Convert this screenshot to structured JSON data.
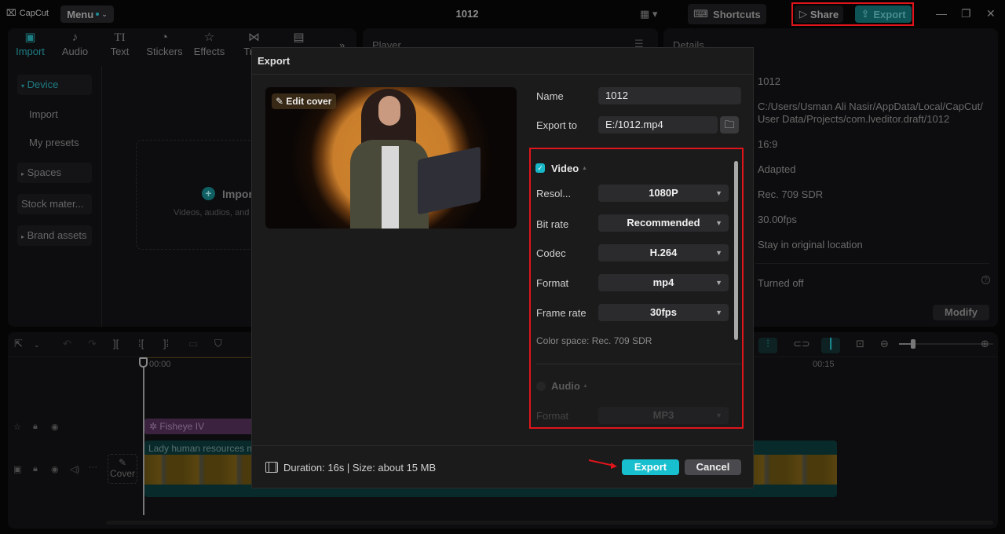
{
  "app": {
    "logo": "CapCut",
    "menu_label": "Menu",
    "project_title": "1012",
    "shortcuts_label": "Shortcuts",
    "share_label": "Share",
    "export_label": "Export",
    "accent_color": "#18bfce",
    "highlight_color": "#e0141b"
  },
  "media_tabs": [
    {
      "label": "Import",
      "icon": "import-icon",
      "active": true
    },
    {
      "label": "Audio",
      "icon": "audio-icon"
    },
    {
      "label": "Text",
      "icon": "text-icon"
    },
    {
      "label": "Stickers",
      "icon": "stickers-icon"
    },
    {
      "label": "Effects",
      "icon": "effects-icon"
    },
    {
      "label": "Tran",
      "icon": "transitions-icon"
    },
    {
      "label": "",
      "icon": "captions-icon"
    }
  ],
  "side_nav": [
    {
      "label": "Device",
      "active": true,
      "expandable": true
    },
    {
      "label": "Import"
    },
    {
      "label": "My presets"
    },
    {
      "label": "Spaces",
      "expandable": true
    },
    {
      "label": "Stock mater..."
    },
    {
      "label": "Brand assets",
      "expandable": true
    }
  ],
  "import_area": {
    "label": "Impor",
    "hint": "Videos, audios, and"
  },
  "player": {
    "label": "Player"
  },
  "details": {
    "label": "Details",
    "values": [
      "1012",
      "C:/Users/Usman Ali Nasir/AppData/Local/CapCut/",
      "User Data/Projects/com.lveditor.draft/1012",
      "16:9",
      "Adapted",
      "Rec. 709 SDR",
      "30.00fps",
      "Stay in original location",
      "Turned off"
    ],
    "modify_label": "Modify"
  },
  "timeline": {
    "time_start": "00:00",
    "time_mark": "00:15",
    "effect_clip": "Fisheye IV",
    "video_clip": "Lady human resources ne",
    "cover_label": "Cover",
    "zoom_level": 0.13
  },
  "export_dialog": {
    "title": "Export",
    "edit_cover_label": "Edit cover",
    "name_label": "Name",
    "name_value": "1012",
    "export_to_label": "Export to",
    "export_to_value": "E:/1012.mp4",
    "video": {
      "title": "Video",
      "checked": true,
      "fields": [
        {
          "label": "Resol...",
          "value": "1080P"
        },
        {
          "label": "Bit rate",
          "value": "Recommended"
        },
        {
          "label": "Codec",
          "value": "H.264"
        },
        {
          "label": "Format",
          "value": "mp4"
        },
        {
          "label": "Frame rate",
          "value": "30fps"
        }
      ],
      "color_space": "Color space: Rec. 709 SDR"
    },
    "audio": {
      "title": "Audio",
      "checked": false,
      "fields": [
        {
          "label": "Format",
          "value": "MP3"
        }
      ]
    },
    "footer_info": "Duration: 16s | Size: about 15 MB",
    "export_label": "Export",
    "cancel_label": "Cancel"
  }
}
